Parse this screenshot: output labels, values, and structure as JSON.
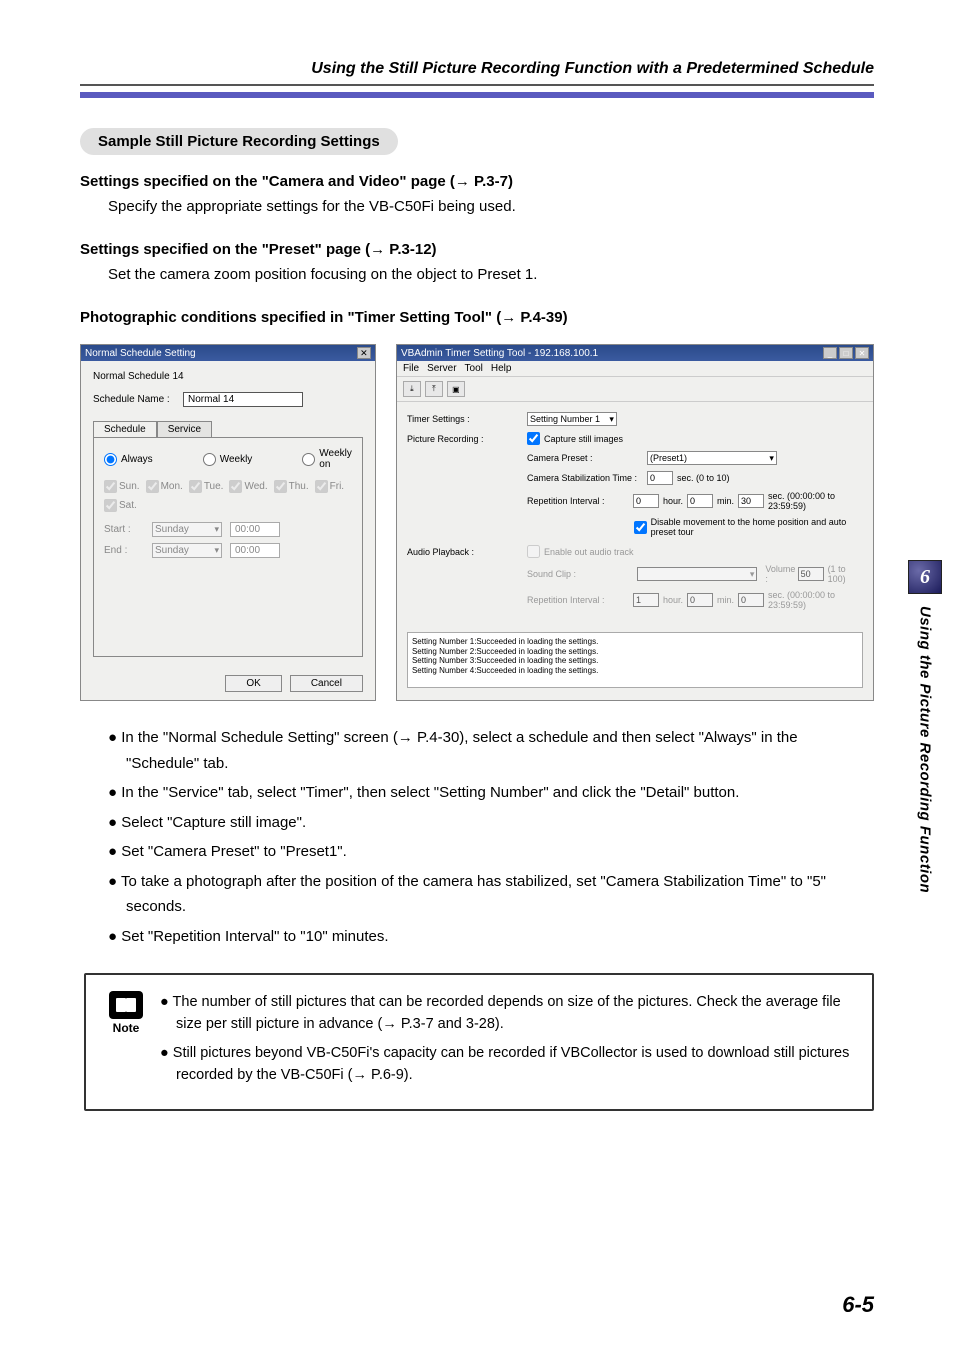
{
  "header_title": "Using the Still Picture Recording Function with a Predetermined Schedule",
  "sample_header": "Sample Still Picture Recording Settings",
  "h1": {
    "title": "Settings specified on the \"Camera and Video\" page (",
    "ref": " P.3-7)",
    "sub": "Specify the appropriate settings for the VB-C50Fi being used."
  },
  "h2": {
    "title": "Settings specified on the \"Preset\" page (",
    "ref": " P.3-12)",
    "sub": "Set the camera zoom position focusing on the object to Preset 1."
  },
  "h3": {
    "title": "Photographic conditions specified in \"Timer Setting Tool\" (",
    "ref": " P.4-39)"
  },
  "dlg_left": {
    "title": "Normal Schedule Setting",
    "name_line": "Normal Schedule 14",
    "name_label": "Schedule Name :",
    "name_value": "Normal 14",
    "tab_schedule": "Schedule",
    "tab_service": "Service",
    "r_always": "Always",
    "r_weekly": "Weekly",
    "r_weeklyon": "Weekly on",
    "days": [
      "Sun.",
      "Mon.",
      "Tue.",
      "Wed.",
      "Thu.",
      "Fri.",
      "Sat."
    ],
    "start_lbl": "Start :",
    "end_lbl": "End :",
    "day_val": "Sunday",
    "time_val": "00:00",
    "ok": "OK",
    "cancel": "Cancel"
  },
  "dlg_right": {
    "title": "VBAdmin Timer Setting Tool - 192.168.100.1",
    "menu": [
      "File",
      "Server",
      "Tool",
      "Help"
    ],
    "timer_settings_lbl": "Timer Settings :",
    "timer_settings_val": "Setting Number 1",
    "picture_lbl": "Picture Recording :",
    "cap_chk": "Capture still images",
    "cam_preset_lbl": "Camera Preset :",
    "cam_preset_val": "(Preset1)",
    "stab_lbl": "Camera Stabilization Time :",
    "stab_val": "0",
    "stab_suffix": "sec. (0 to 10)",
    "rep_lbl": "Repetition Interval :",
    "rep_h": "0",
    "rep_m": "0",
    "rep_s": "30",
    "rep_range": "sec. (00:00:00 to 23:59:59)",
    "disable_move": "Disable movement to the home position and auto preset tour",
    "audio_lbl": "Audio Playback :",
    "audio_chk": "Enable out audio track",
    "sound_lbl": "Sound Clip :",
    "vol_lbl": "Volume :",
    "vol_val": "50",
    "vol_range": "(1 to 100)",
    "rep2_lbl": "Repetition Interval :",
    "rep2_range": "sec. (00:00:00 to 23:59:59)",
    "logs": [
      "Setting Number 1:Succeeded in loading the settings.",
      "Setting Number 2:Succeeded in loading the settings.",
      "Setting Number 3:Succeeded in loading the settings.",
      "Setting Number 4:Succeeded in loading the settings."
    ],
    "hour": "hour.",
    "min": "min.",
    "sec": "sec."
  },
  "bullets": [
    "In the \"Normal Schedule Setting\" screen (→ P.4-30), select a schedule and then select \"Always\" in the \"Schedule\" tab.",
    "In the \"Service\" tab, select \"Timer\", then select \"Setting Number\" and click the \"Detail\" button.",
    "Select \"Capture still image\".",
    "Set \"Camera Preset\" to \"Preset1\".",
    "To take a photograph after the position of the camera has stabilized, set \"Camera Stabilization Time\" to \"5\" seconds.",
    "Set \"Repetition Interval\" to \"10\" minutes."
  ],
  "note": {
    "label": "Note",
    "items": [
      "The number of still pictures that can be recorded depends on size of the pictures. Check the average file size per still picture in advance (→ P.3-7 and 3-28).",
      "Still pictures beyond VB-C50Fi's capacity can be recorded if VBCollector is used to download still pictures recorded by the VB-C50Fi (→ P.6-9)."
    ]
  },
  "side": {
    "num": "6",
    "text": "Using the Picture Recording Function"
  },
  "page_num": "6-5"
}
